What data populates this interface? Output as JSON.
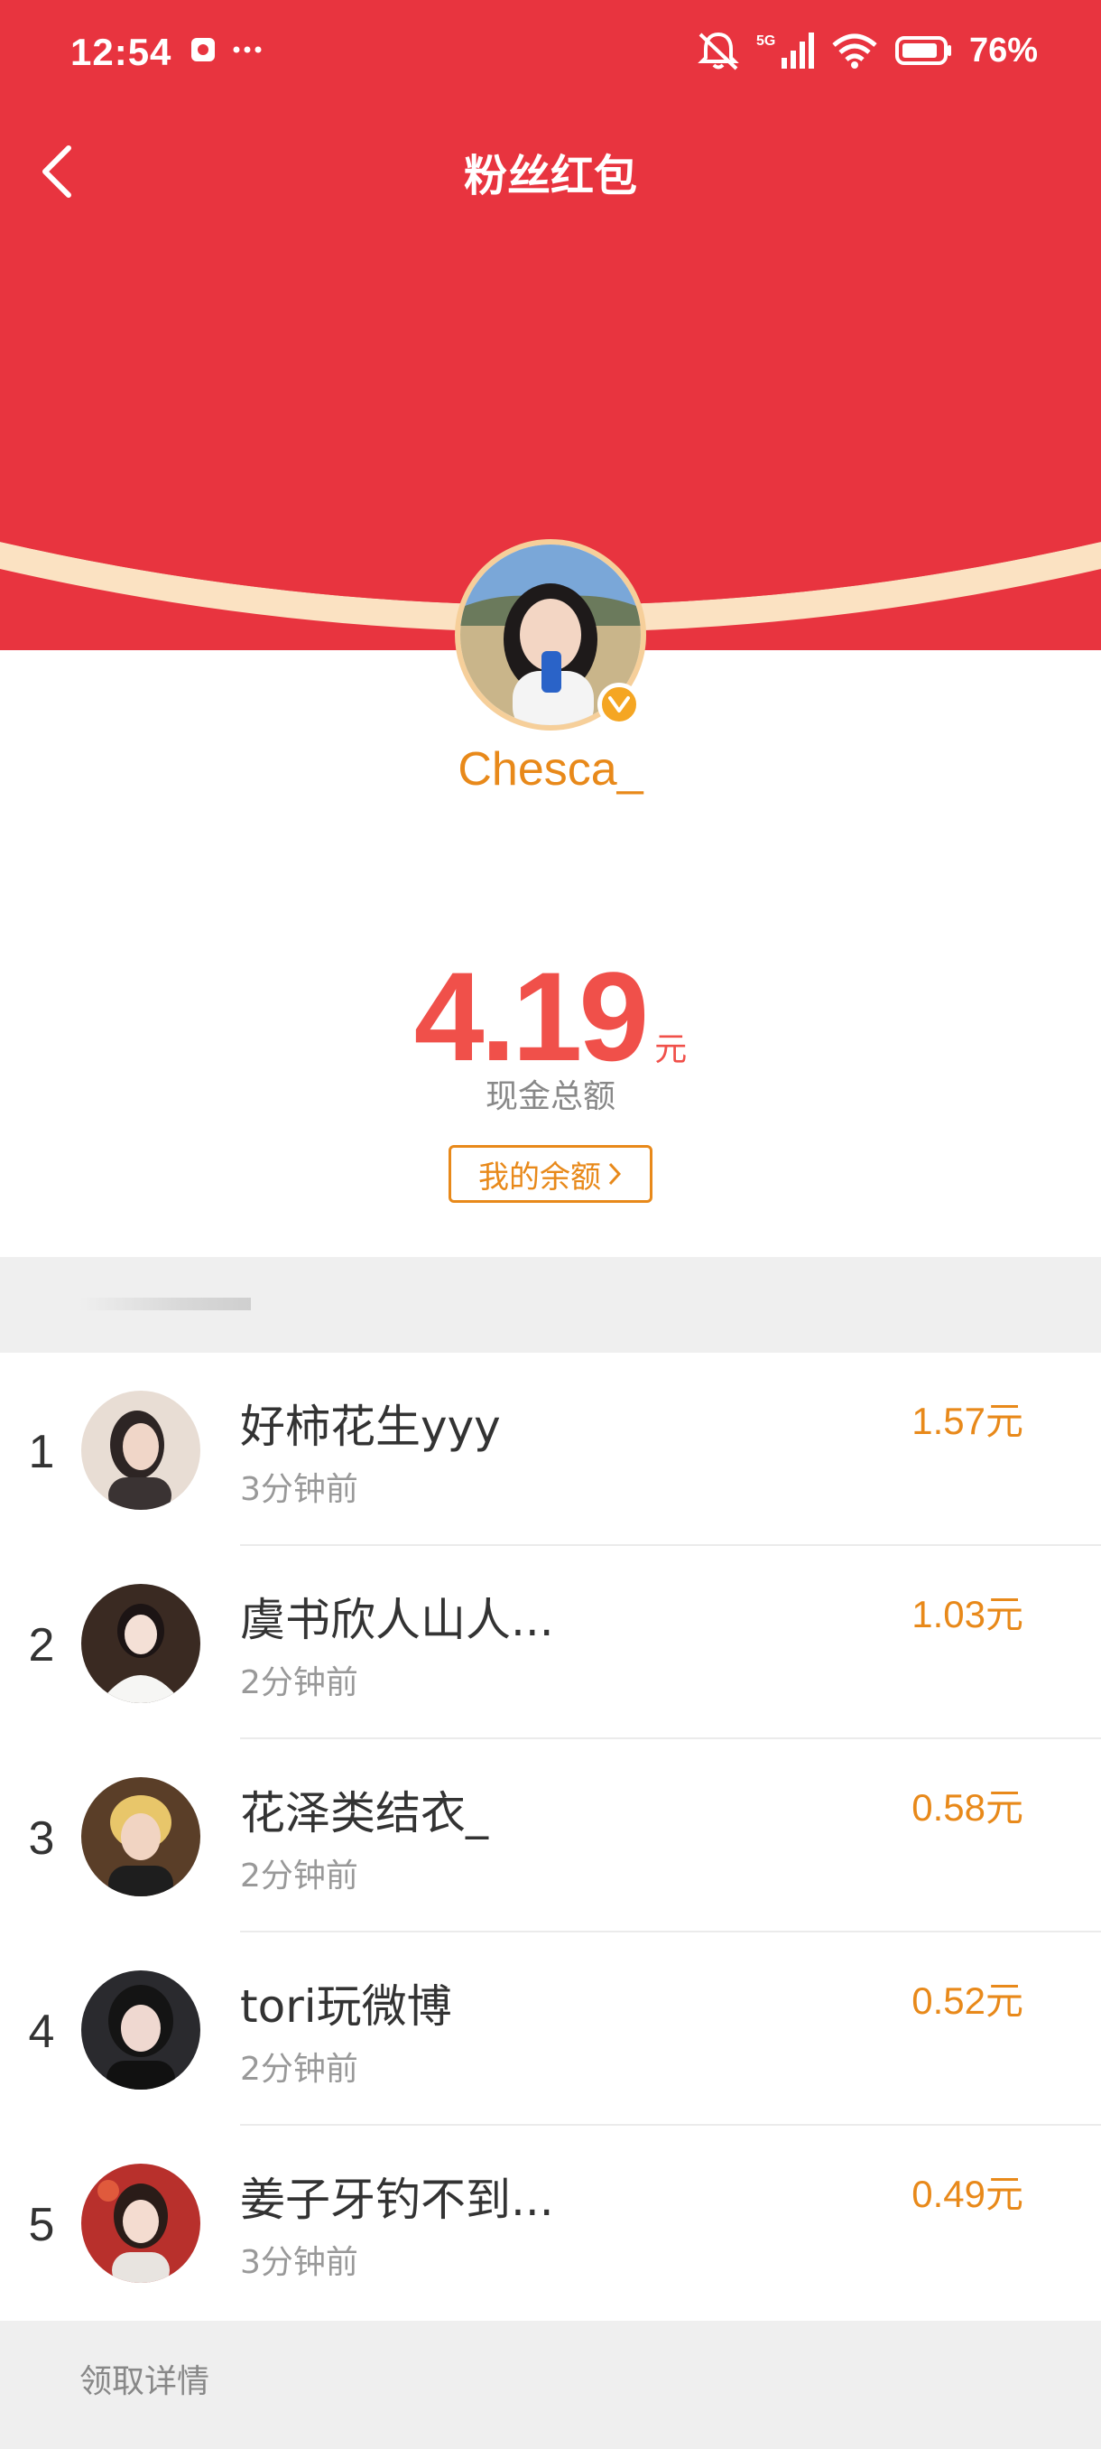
{
  "status_bar": {
    "time": "12:54",
    "battery": "76%",
    "network": "5G"
  },
  "header": {
    "title": "粉丝红包",
    "color": "#e8343f"
  },
  "sender": {
    "username": "Chesca_"
  },
  "amount": {
    "value": "4.19",
    "unit": "元",
    "label": "现金总额",
    "balance_button": "我的余额"
  },
  "recipients": [
    {
      "rank": "1",
      "name": "好柿花生yyy",
      "time": "3分钟前",
      "amount": "1.57元"
    },
    {
      "rank": "2",
      "name": "虞书欣人山人...",
      "time": "2分钟前",
      "amount": "1.03元"
    },
    {
      "rank": "3",
      "name": "花泽类结衣_",
      "time": "2分钟前",
      "amount": "0.58元"
    },
    {
      "rank": "4",
      "name": "tori玩微博",
      "time": "2分钟前",
      "amount": "0.52元"
    },
    {
      "rank": "5",
      "name": "姜子牙钓不到...",
      "time": "3分钟前",
      "amount": "0.49元"
    }
  ],
  "footer": {
    "label": "领取详情"
  },
  "colors": {
    "accent": "#e8891a",
    "amount": "#f0504a",
    "red": "#e8343f"
  }
}
